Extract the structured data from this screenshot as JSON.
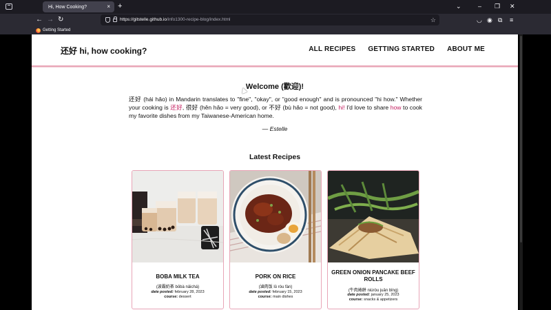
{
  "browser": {
    "tab_title": "Hi, How Cooking?",
    "tab_close": "×",
    "new_tab": "+",
    "url_host": "https://gitstelle.github.io",
    "url_path": "/info1300-recipe-blog/index.html",
    "bookmark": "Getting Started",
    "icons": [
      "window-icon",
      "back-icon",
      "forward-icon",
      "reload-icon",
      "shield-icon",
      "lock-icon",
      "star-icon",
      "pocket-icon",
      "account-icon",
      "extensions-icon",
      "menu-icon",
      "chevron-down-icon",
      "minimize-icon",
      "maximize-icon",
      "close-icon"
    ]
  },
  "site": {
    "brand": "还好 hi, how cooking?",
    "nav": [
      "ALL RECIPES",
      "GETTING STARTED",
      "ABOUT ME"
    ]
  },
  "welcome": {
    "heading": "Welcome (歡迎)!",
    "p1": "还好 (hái hǎo) in Mandarin translates to \"fine\", \"okay\", or \"good enough\" and is pronounced \"hi how.\" Whether your cooking is ",
    "pink1": "还好",
    "p2": ", 很好 (hěn hǎo = very good), or 不好 (bù hǎo = not good), ",
    "pink2": "hi!",
    "p3": " I'd love to share ",
    "pink3": "how",
    "p4": " to cook my favorite dishes from my Taiwanese-American home.",
    "signature": "— Estelle"
  },
  "latest": {
    "heading": "Latest Recipes",
    "date_label": "date posted:",
    "course_label": "course:",
    "cards": [
      {
        "title": "BOBA MILK TEA",
        "subtitle": "(波霸奶茶 bōbà nǎichá)",
        "date": "february 28, 2023",
        "course": "dessert"
      },
      {
        "title": "PORK ON RICE",
        "subtitle": "(滷肉饭 lǔ ròu fàn)",
        "date": "february 15, 2023",
        "course": "main dishes"
      },
      {
        "title": "GREEN ONION PANCAKE BEEF ROLLS",
        "subtitle": "(牛肉捲餅 niúròu juǎn bǐng)",
        "date": "january 25, 2023",
        "course": "snacks & appetizers"
      }
    ]
  },
  "colors": {
    "accent_pink": "#c2185b",
    "border_pink": "#e8a4b6",
    "chrome_dark": "#1c1b22"
  }
}
